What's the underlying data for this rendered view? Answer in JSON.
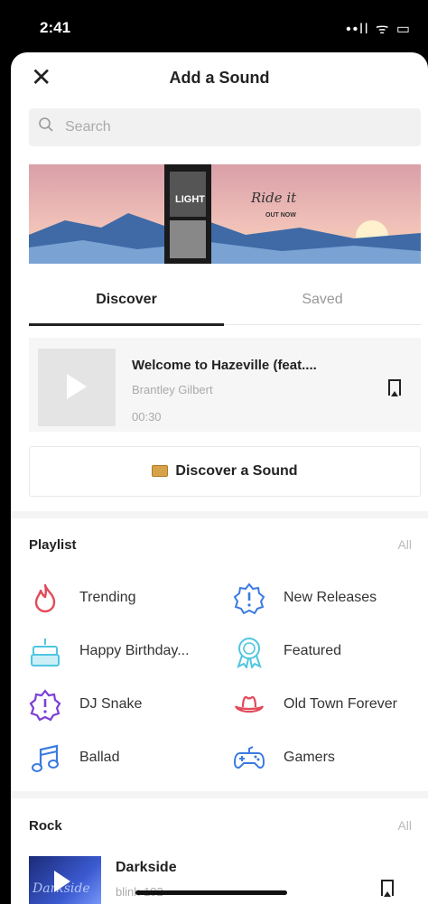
{
  "status": {
    "time": "2:41",
    "icons": "••ll ᯤ ▭"
  },
  "header": {
    "close": "✕",
    "title": "Add a Sound"
  },
  "search": {
    "placeholder": "Search"
  },
  "banner": {
    "script_text": "Ride it",
    "sub_text": "OUT NOW",
    "side_text": "LIGHT"
  },
  "tabs": [
    {
      "label": "Discover",
      "active": true
    },
    {
      "label": "Saved",
      "active": false
    }
  ],
  "featured": {
    "title": "Welcome to Hazeville (feat....",
    "artist": "Brantley Gilbert",
    "duration": "00:30"
  },
  "discover_button": {
    "label": "Discover a Sound"
  },
  "playlist": {
    "title": "Playlist",
    "all": "All",
    "items": [
      {
        "label": "Trending",
        "icon": "flame-icon",
        "color": "#e2495a"
      },
      {
        "label": "New Releases",
        "icon": "new-badge-icon",
        "color": "#3a7be0"
      },
      {
        "label": "Happy Birthday...",
        "icon": "cake-icon",
        "color": "#4fc6df"
      },
      {
        "label": "Featured",
        "icon": "award-icon",
        "color": "#4fc6df"
      },
      {
        "label": "DJ Snake",
        "icon": "exclamation-badge-icon",
        "color": "#7b3fd6"
      },
      {
        "label": "Old Town Forever",
        "icon": "cowboy-hat-icon",
        "color": "#e2495a"
      },
      {
        "label": "Ballad",
        "icon": "music-note-icon",
        "color": "#3a7be0"
      },
      {
        "label": "Gamers",
        "icon": "gamepad-icon",
        "color": "#3a7be0"
      }
    ]
  },
  "rock": {
    "title": "Rock",
    "all": "All",
    "items": [
      {
        "title": "Darkside",
        "artist": "blink-182",
        "thumb_text": "Darkside"
      }
    ]
  }
}
